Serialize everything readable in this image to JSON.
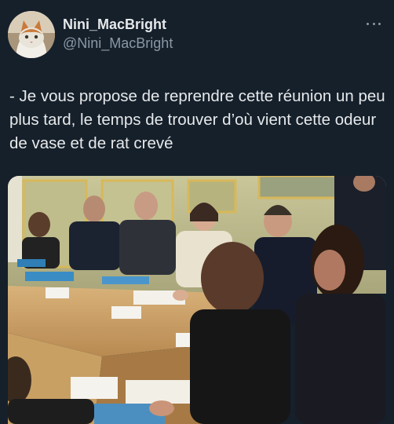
{
  "user": {
    "display_name": "Nini_MacBright",
    "handle": "@Nini_MacBright",
    "avatar_icon": "cat-avatar-icon"
  },
  "tweet": {
    "text": "- Je vous propose de reprendre cette réunion un peu plus tard, le temps de trouver d’où vient cette odeur de vase et de rat crevé"
  },
  "icons": {
    "more": "more-options-icon"
  },
  "colors": {
    "background": "#15202b",
    "text": "#e7e9ea",
    "secondary_text": "#8b98a5"
  }
}
